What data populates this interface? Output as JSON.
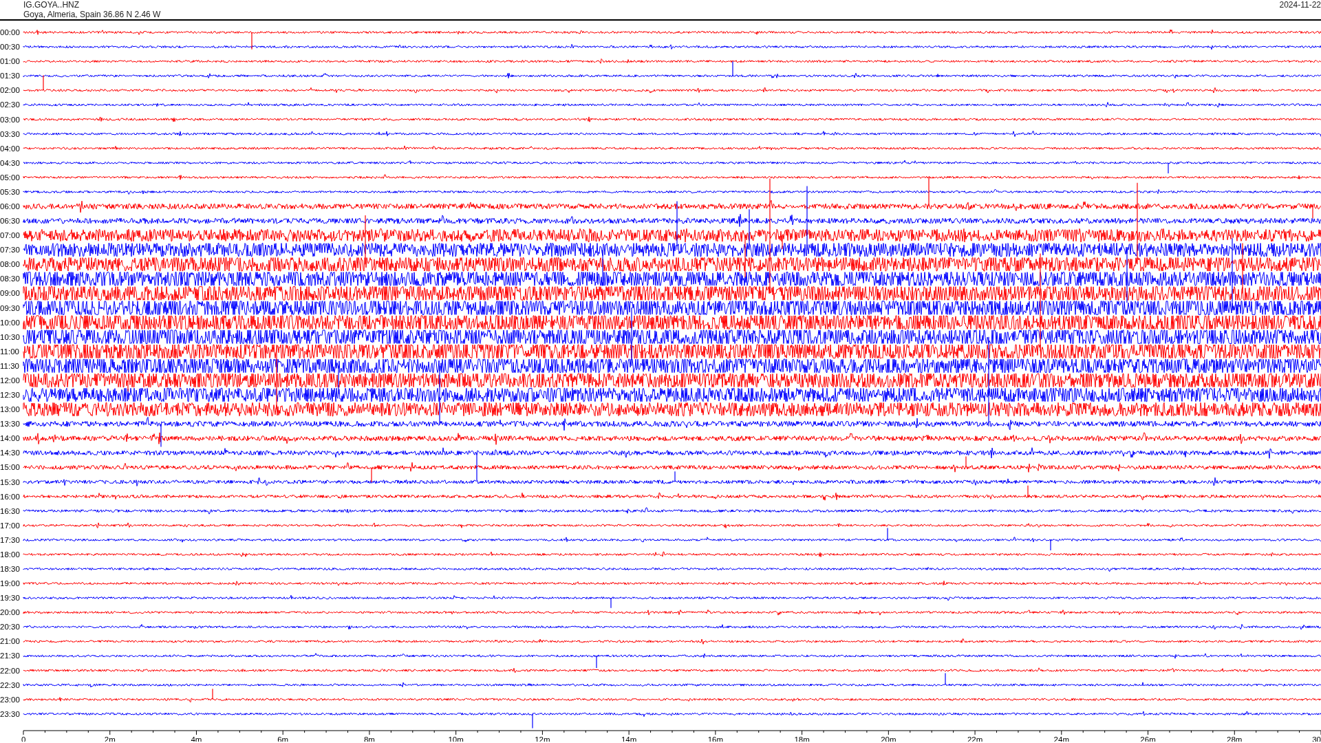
{
  "header": {
    "station": "IG.GOYA..HNZ",
    "location": "Goya, Almeria, Spain  36.86 N 2.46 W",
    "date": "2024-11-22"
  },
  "rows": [
    {
      "time": "00:00",
      "color": "#ff0000"
    },
    {
      "time": "00:30",
      "color": "#0000ff"
    },
    {
      "time": "01:00",
      "color": "#ff0000"
    },
    {
      "time": "01:30",
      "color": "#0000ff"
    },
    {
      "time": "02:00",
      "color": "#ff0000"
    },
    {
      "time": "02:30",
      "color": "#0000ff"
    },
    {
      "time": "03:00",
      "color": "#ff0000"
    },
    {
      "time": "03:30",
      "color": "#0000ff"
    },
    {
      "time": "04:00",
      "color": "#ff0000"
    },
    {
      "time": "04:30",
      "color": "#0000ff"
    },
    {
      "time": "05:00",
      "color": "#ff0000"
    },
    {
      "time": "05:30",
      "color": "#0000ff"
    },
    {
      "time": "06:00",
      "color": "#ff0000"
    },
    {
      "time": "06:30",
      "color": "#0000ff"
    },
    {
      "time": "07:00",
      "color": "#ff0000"
    },
    {
      "time": "07:30",
      "color": "#0000ff"
    },
    {
      "time": "08:00",
      "color": "#ff0000"
    },
    {
      "time": "08:30",
      "color": "#0000ff"
    },
    {
      "time": "09:00",
      "color": "#ff0000"
    },
    {
      "time": "09:30",
      "color": "#0000ff"
    },
    {
      "time": "10:00",
      "color": "#ff0000"
    },
    {
      "time": "10:30",
      "color": "#0000ff"
    },
    {
      "time": "11:00",
      "color": "#ff0000"
    },
    {
      "time": "11:30",
      "color": "#0000ff"
    },
    {
      "time": "12:00",
      "color": "#ff0000"
    },
    {
      "time": "12:30",
      "color": "#0000ff"
    },
    {
      "time": "13:00",
      "color": "#ff0000"
    },
    {
      "time": "13:30",
      "color": "#0000ff"
    },
    {
      "time": "14:00",
      "color": "#ff0000"
    },
    {
      "time": "14:30",
      "color": "#0000ff"
    },
    {
      "time": "15:00",
      "color": "#ff0000"
    },
    {
      "time": "15:30",
      "color": "#0000ff"
    },
    {
      "time": "16:00",
      "color": "#ff0000"
    },
    {
      "time": "16:30",
      "color": "#0000ff"
    },
    {
      "time": "17:00",
      "color": "#ff0000"
    },
    {
      "time": "17:30",
      "color": "#0000ff"
    },
    {
      "time": "18:00",
      "color": "#ff0000"
    },
    {
      "time": "18:30",
      "color": "#0000ff"
    },
    {
      "time": "19:00",
      "color": "#ff0000"
    },
    {
      "time": "19:30",
      "color": "#0000ff"
    },
    {
      "time": "20:00",
      "color": "#ff0000"
    },
    {
      "time": "20:30",
      "color": "#0000ff"
    },
    {
      "time": "21:00",
      "color": "#ff0000"
    },
    {
      "time": "21:30",
      "color": "#0000ff"
    },
    {
      "time": "22:00",
      "color": "#ff0000"
    },
    {
      "time": "22:30",
      "color": "#0000ff"
    },
    {
      "time": "23:00",
      "color": "#ff0000"
    },
    {
      "time": "23:30",
      "color": "#0000ff"
    }
  ],
  "x_axis": {
    "labels": [
      "0",
      "2m",
      "4m",
      "6m",
      "8m",
      "10m",
      "12m",
      "14m",
      "16m",
      "18m",
      "20m",
      "22m",
      "24m",
      "26m",
      "28m",
      "30"
    ]
  }
}
